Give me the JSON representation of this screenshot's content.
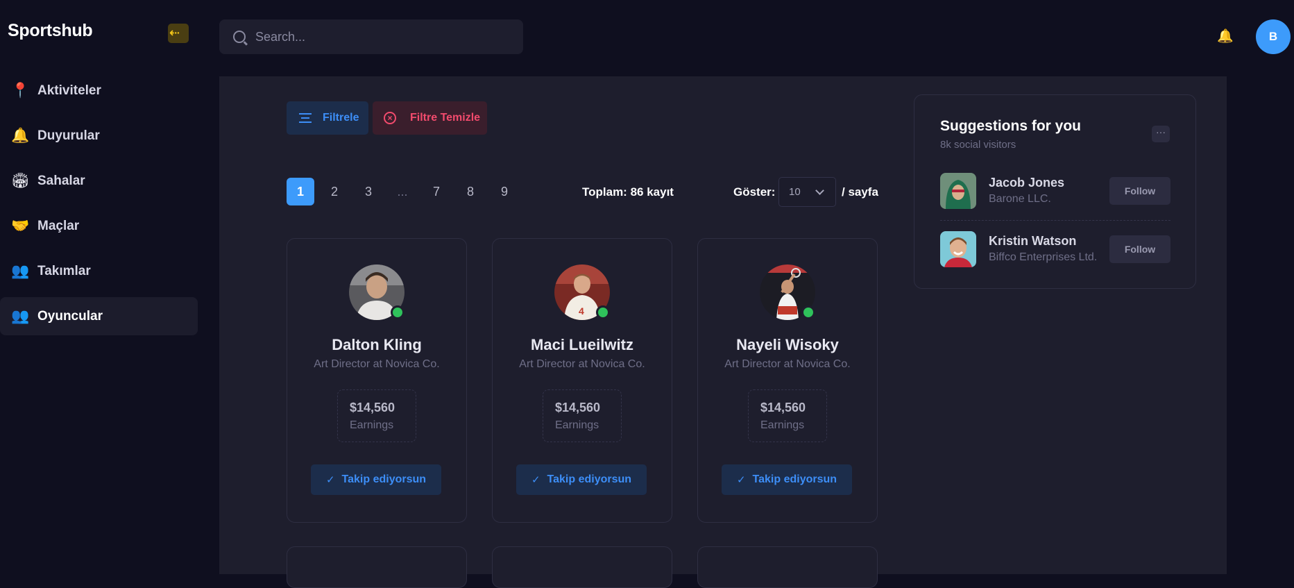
{
  "app": {
    "brand": "Sportshub",
    "collapse_icon": "arrow-left-icon"
  },
  "sidebar": {
    "items": [
      {
        "label": "Aktiviteler",
        "icon": "📍",
        "icon_name": "pin-icon",
        "active": false
      },
      {
        "label": "Duyurular",
        "icon": "🔔",
        "icon_name": "bell-icon",
        "active": false
      },
      {
        "label": "Sahalar",
        "icon": "🏟",
        "icon_name": "stadium-icon",
        "active": false
      },
      {
        "label": "Maçlar",
        "icon": "🤝",
        "icon_name": "handshake-icon",
        "active": false
      },
      {
        "label": "Takımlar",
        "icon": "👥",
        "icon_name": "team-icon",
        "active": false
      },
      {
        "label": "Oyuncular",
        "icon": "👥",
        "icon_name": "players-icon",
        "active": true
      }
    ]
  },
  "topbar": {
    "search_placeholder": "Search...",
    "bell": "🔔",
    "avatar_initial": "B",
    "avatar_color": "#3d9bfb"
  },
  "filters": {
    "filter_label": "Filtrele",
    "clear_label": "Filtre Temizle"
  },
  "pagination": {
    "pages": [
      "1",
      "2",
      "3",
      "...",
      "7",
      "8",
      "9"
    ],
    "current": "1",
    "total_text": "Toplam: 86 kayıt",
    "show_label": "Göster:",
    "page_size": "10",
    "per_page_label": "/ sayfa"
  },
  "players": [
    {
      "name": "Dalton Kling",
      "role": "Art Director at Novica Co.",
      "earnings": "$14,560",
      "earnings_label": "Earnings",
      "follow_label": "Takip ediyorsun"
    },
    {
      "name": "Maci Lueilwitz",
      "role": "Art Director at Novica Co.",
      "earnings": "$14,560",
      "earnings_label": "Earnings",
      "follow_label": "Takip ediyorsun"
    },
    {
      "name": "Nayeli Wisoky",
      "role": "Art Director at Novica Co.",
      "earnings": "$14,560",
      "earnings_label": "Earnings",
      "follow_label": "Takip ediyorsun"
    }
  ],
  "suggestions": {
    "title": "Suggestions for you",
    "subtitle": "8k social visitors",
    "more_icon": "···",
    "items": [
      {
        "name": "Jacob Jones",
        "company": "Barone LLC.",
        "follow_label": "Follow"
      },
      {
        "name": "Kristin Watson",
        "company": "Biffco Enterprises Ltd.",
        "follow_label": "Follow"
      }
    ]
  },
  "colors": {
    "accent": "#3d9bfb",
    "danger": "#f24b6d",
    "online": "#2fc25b",
    "background": "#0f0f1f",
    "panel": "#1e1e2d"
  }
}
